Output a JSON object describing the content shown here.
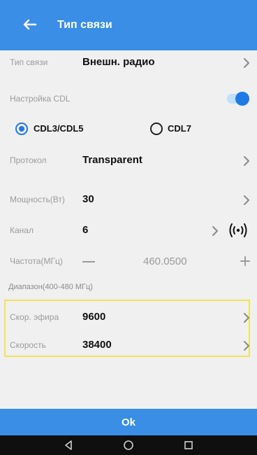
{
  "header": {
    "title": "Тип связи"
  },
  "rows": {
    "connection_type": {
      "label": "Тип связи",
      "value": "Внешн. радио"
    },
    "cdl_setting": {
      "label": "Настройка CDL"
    },
    "radio_cdl3": {
      "label": "CDL3/CDL5",
      "selected": true
    },
    "radio_cdl7": {
      "label": "CDL7",
      "selected": false
    },
    "protocol": {
      "label": "Протокол",
      "value": "Transparent"
    },
    "power": {
      "label": "Мощность(Вт)",
      "value": "30"
    },
    "channel": {
      "label": "Канал",
      "value": "6"
    },
    "frequency": {
      "label": "Частота(МГц)",
      "value": "460.0500"
    },
    "range": "Диапазон(400-480 МГц)",
    "air_speed": {
      "label": "Скор. эфира",
      "value": "9600"
    },
    "speed": {
      "label": "Скорость",
      "value": "38400"
    }
  },
  "footer": {
    "ok_label": "Ok"
  },
  "icons": {
    "back": "arrow-left-icon",
    "chevron": "chevron-right-icon",
    "wifi": "radio-signal-icon",
    "minus": "minus-icon",
    "plus": "plus-icon",
    "nav_back": "triangle-left-icon",
    "nav_home": "circle-icon",
    "nav_recents": "square-icon"
  },
  "colors": {
    "accent": "#3a8ee6",
    "highlight": "#f1e25a"
  }
}
